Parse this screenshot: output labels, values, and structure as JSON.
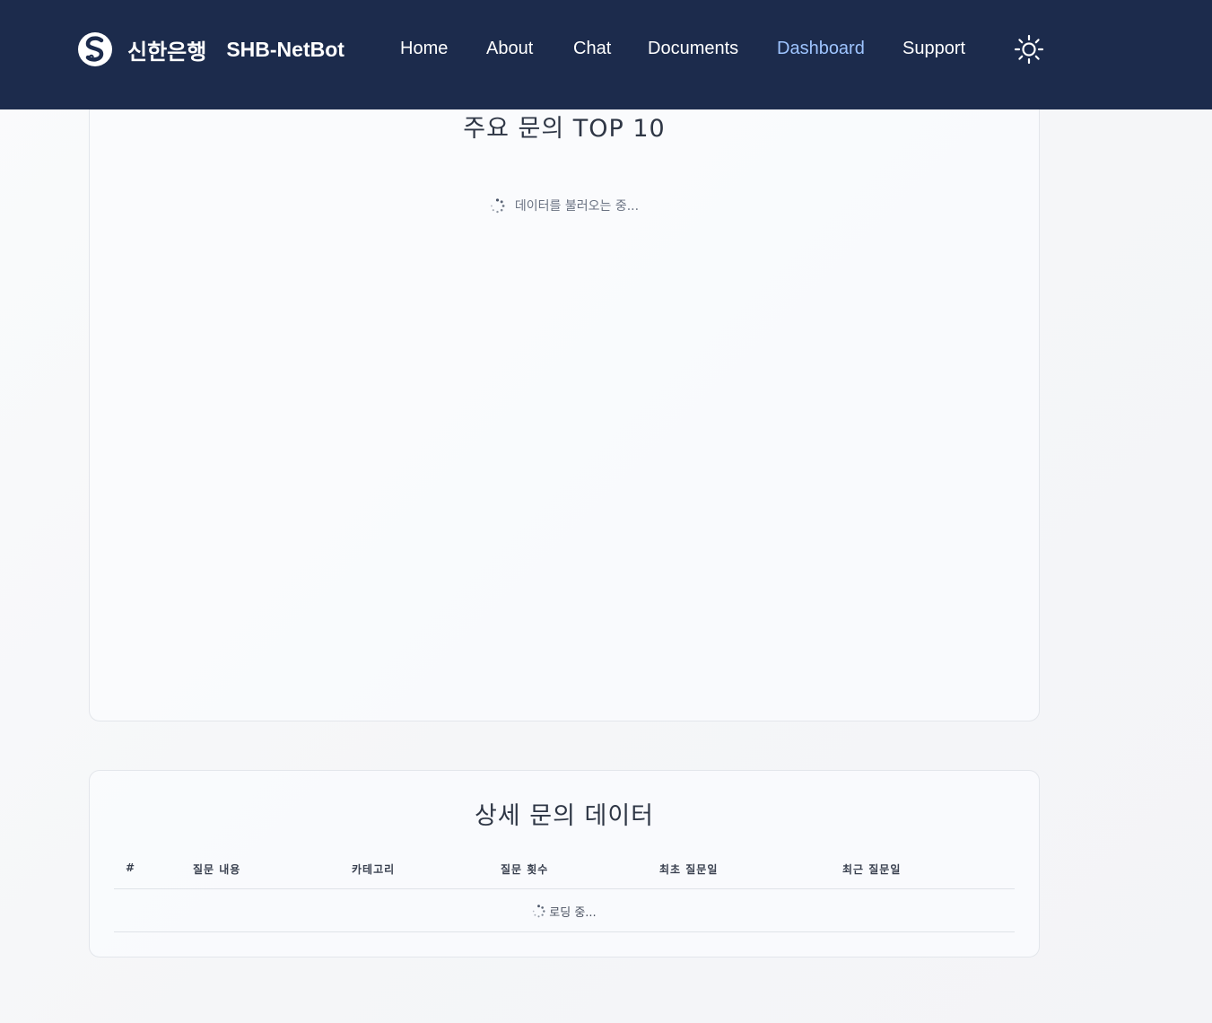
{
  "navbar": {
    "brand_korean": "신한은행",
    "brand_name": "SHB-NetBot",
    "links": [
      {
        "label": "Home",
        "active": false
      },
      {
        "label": "About",
        "active": false
      },
      {
        "label": "Chat",
        "active": false
      },
      {
        "label": "Documents",
        "active": false
      },
      {
        "label": "Dashboard",
        "active": true
      },
      {
        "label": "Support",
        "active": false
      }
    ],
    "theme_icon": "sun-icon",
    "colors": {
      "background": "#1c2b4c",
      "active_link": "#9ec4ff",
      "link": "#ffffff"
    }
  },
  "top_card": {
    "title": "주요 문의 TOP 10",
    "loading_text": "데이터를 불러오는 중..."
  },
  "detail_card": {
    "title": "상세 문의 데이터",
    "columns": [
      "#",
      "질문 내용",
      "카테고리",
      "질문 횟수",
      "최초 질문일",
      "최근 질문일"
    ],
    "loading_text": "로딩 중..."
  }
}
